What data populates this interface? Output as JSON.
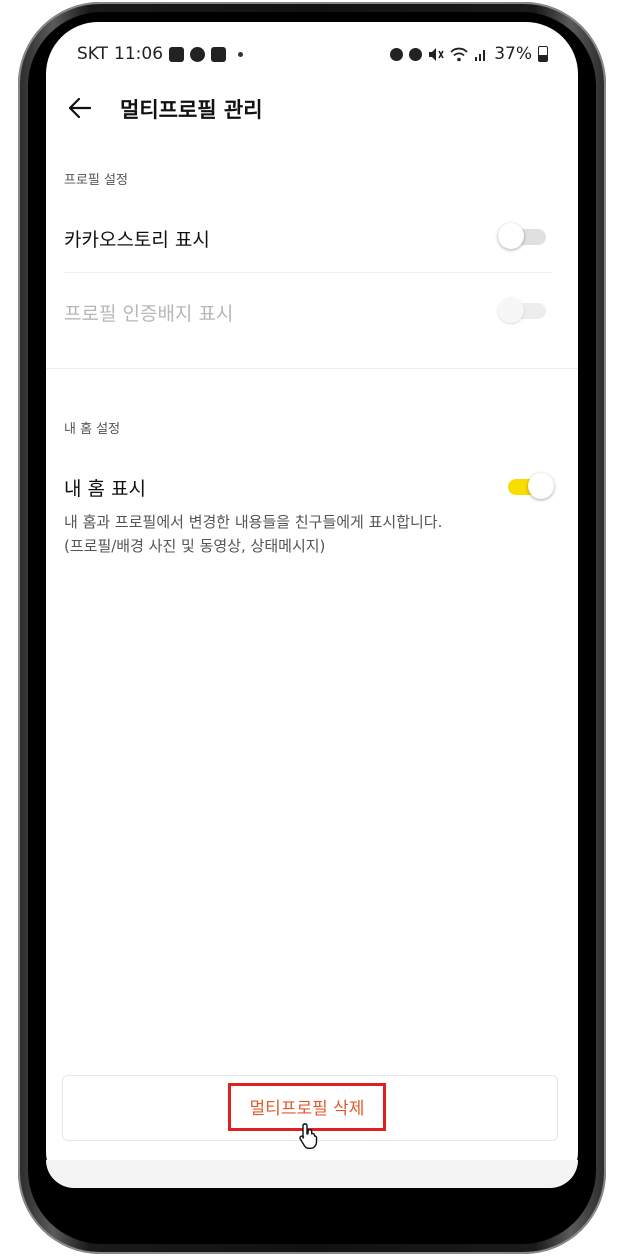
{
  "status_bar": {
    "carrier": "SKT",
    "time": "11:06",
    "battery_percent": "37%"
  },
  "header": {
    "title": "멀티프로필 관리"
  },
  "profile_section": {
    "label": "프로필 설정",
    "rows": [
      {
        "label": "카카오스토리 표시",
        "toggle_on": false,
        "disabled": false
      },
      {
        "label": "프로필 인증배지 표시",
        "toggle_on": false,
        "disabled": true
      }
    ]
  },
  "home_section": {
    "label": "내 홈 설정",
    "row_label": "내 홈 표시",
    "toggle_on": true,
    "description_line1": "내 홈과 프로필에서 변경한 내용들을 친구들에게 표시합니다.",
    "description_line2": "(프로필/배경 사진 및 동영상, 상태메시지)"
  },
  "delete_button": {
    "label": "멀티프로필 삭제"
  },
  "colors": {
    "toggle_on": "#fadc00",
    "delete_text": "#e05a2e",
    "highlight": "#e02020"
  }
}
